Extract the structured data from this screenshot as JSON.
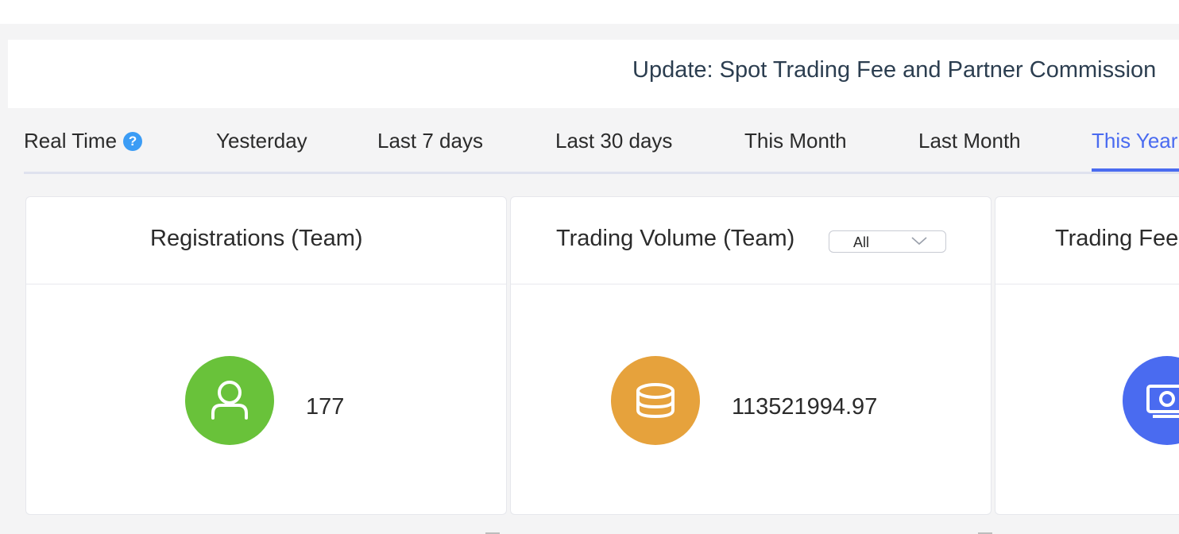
{
  "banner": {
    "text": "Update: Spot Trading Fee and Partner Commission"
  },
  "tabs": [
    {
      "label": "Real Time",
      "active": false
    },
    {
      "label": "Yesterday",
      "active": false
    },
    {
      "label": "Last 7 days",
      "active": false
    },
    {
      "label": "Last 30 days",
      "active": false
    },
    {
      "label": "This Month",
      "active": false
    },
    {
      "label": "Last Month",
      "active": false
    },
    {
      "label": "This Year",
      "active": true
    }
  ],
  "help_icon_glyph": "?",
  "cards": [
    {
      "title": "Registrations (Team)",
      "icon": "user-icon",
      "icon_color": "#69c23a",
      "value": "177"
    },
    {
      "title": "Trading Volume (Team)",
      "select_value": "All",
      "icon": "coins-icon",
      "icon_color": "#e6a23c",
      "value": "113521994.97"
    },
    {
      "title": "Trading Fee",
      "icon": "money-icon",
      "icon_color": "#4a6bf0",
      "value": ""
    }
  ],
  "colors": {
    "accent": "#4a6bf0",
    "help": "#3b9cf5"
  }
}
